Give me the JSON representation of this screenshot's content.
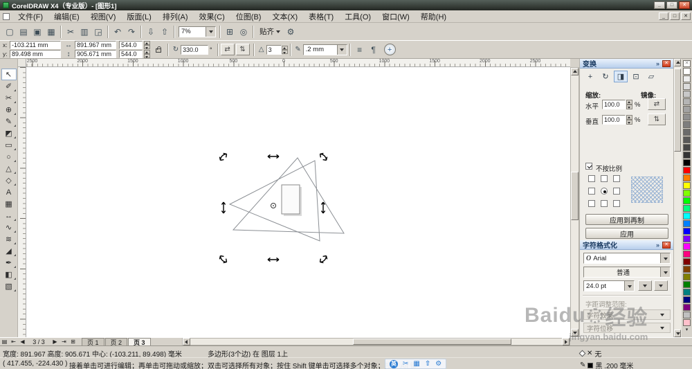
{
  "window": {
    "title": "CorelDRAW X4（专业版）- [图形1]",
    "minimize_icon": "_",
    "maximize_icon": "□",
    "close_icon": "✕"
  },
  "menu": {
    "items": [
      "文件(F)",
      "编辑(E)",
      "视图(V)",
      "版面(L)",
      "排列(A)",
      "效果(C)",
      "位图(B)",
      "文本(X)",
      "表格(T)",
      "工具(O)",
      "窗口(W)",
      "帮助(H)"
    ]
  },
  "toolbar": {
    "file_icons": [
      {
        "name": "new-document-icon",
        "glyph": "▢"
      },
      {
        "name": "open-icon",
        "glyph": "▤"
      },
      {
        "name": "save-icon",
        "glyph": "▣"
      },
      {
        "name": "print-icon",
        "glyph": "▦"
      }
    ],
    "edit_icons": [
      {
        "name": "cut-icon",
        "glyph": "✂"
      },
      {
        "name": "copy-icon",
        "glyph": "▥"
      },
      {
        "name": "paste-icon",
        "glyph": "◲"
      }
    ],
    "undo_icons": [
      {
        "name": "undo-icon",
        "glyph": "↶"
      },
      {
        "name": "redo-icon",
        "glyph": "↷"
      }
    ],
    "io_icons": [
      {
        "name": "import-icon",
        "glyph": "⇩"
      },
      {
        "name": "export-icon",
        "glyph": "⇧"
      }
    ],
    "zoom_value": "7%",
    "app_icons": [
      {
        "name": "app-launcher-icon",
        "glyph": "⊞"
      },
      {
        "name": "corel-online-icon",
        "glyph": "◎"
      }
    ],
    "snap_label": "贴齐",
    "options_icon": "⚙"
  },
  "propbar": {
    "x_label": "x:",
    "x_value": "-103.211 mm",
    "y_label": "y:",
    "y_value": "89.498 mm",
    "width_value": "891.967 mm",
    "height_value": "905.671 mm",
    "scale_h_value": "544.0",
    "scale_v_value": "544.0",
    "angle_value": "330.0",
    "angle_unit": "°",
    "points_value": "3",
    "outline_value": ".2 mm",
    "icons": {
      "rotate": "↻",
      "mirror_h": "⇄",
      "mirror_v": "⇅",
      "polygon": "△",
      "pen": "✎",
      "size_h": "↔",
      "size_v": "↕",
      "wrap": "≡",
      "paragraph": "¶",
      "quick": "+"
    }
  },
  "ruler": {
    "labels": [
      "2500",
      "2000",
      "1500",
      "1000",
      "500",
      "0",
      "500",
      "1000",
      "1500",
      "2000",
      "2500"
    ]
  },
  "toolbox": {
    "tools": [
      {
        "name": "pick-tool",
        "glyph": "↖",
        "active": true
      },
      {
        "name": "shape-tool",
        "glyph": "✐",
        "fly": true
      },
      {
        "name": "crop-tool",
        "glyph": "✂",
        "fly": true
      },
      {
        "name": "zoom-tool",
        "glyph": "⊕",
        "fly": true
      },
      {
        "name": "freehand-tool",
        "glyph": "✎",
        "fly": true
      },
      {
        "name": "smart-fill-tool",
        "glyph": "◩",
        "fly": true
      },
      {
        "name": "rectangle-tool",
        "glyph": "▭",
        "fly": true
      },
      {
        "name": "ellipse-tool",
        "glyph": "○",
        "fly": true
      },
      {
        "name": "polygon-tool",
        "glyph": "△",
        "fly": true
      },
      {
        "name": "basic-shapes-tool",
        "glyph": "◇",
        "fly": true
      },
      {
        "name": "text-tool",
        "glyph": "A"
      },
      {
        "name": "table-tool",
        "glyph": "▦"
      },
      {
        "name": "dimension-tool",
        "glyph": "↔",
        "fly": true
      },
      {
        "name": "connector-tool",
        "glyph": "∿",
        "fly": true
      },
      {
        "name": "blend-tool",
        "glyph": "≋",
        "fly": true
      },
      {
        "name": "eyedropper-tool",
        "glyph": "◢",
        "fly": true
      },
      {
        "name": "outline-pen-tool",
        "glyph": "✒",
        "fly": true
      },
      {
        "name": "fill-tool",
        "glyph": "◧",
        "fly": true
      },
      {
        "name": "interactive-fill-tool",
        "glyph": "▧",
        "fly": true
      }
    ]
  },
  "transform_docker": {
    "title": "变换",
    "modes": [
      {
        "name": "transform-position-button",
        "glyph": "+"
      },
      {
        "name": "transform-rotation-button",
        "glyph": "↻"
      },
      {
        "name": "transform-scale-mirror-button",
        "glyph": "◨",
        "active": true
      },
      {
        "name": "transform-size-button",
        "glyph": "⊡"
      },
      {
        "name": "transform-skew-button",
        "glyph": "▱"
      }
    ],
    "scale_label": "缩放:",
    "mirror_label": "镜像:",
    "h_label": "水平",
    "v_label": "垂直",
    "h_value": "100.0",
    "v_value": "100.0",
    "percent": "%",
    "mirror_h_icon": "⇄",
    "mirror_v_icon": "⇅",
    "nonproportional_label": "不按比例",
    "apply_duplicate_label": "应用到再制",
    "apply_label": "应用"
  },
  "char_docker": {
    "title": "字符格式化",
    "font_icon": "O",
    "font_value": "Arial",
    "style_value": "普通",
    "size_value": "24.0 pt",
    "kerning_label": "字距调整范围:",
    "section1_label": "字符效果",
    "section2_label": "字符位移"
  },
  "docker_icons": {
    "collapse": "»",
    "close": "✕"
  },
  "palette": {
    "none_mark": "✕",
    "down_icon": "▾",
    "colors": [
      "none",
      "#FFFFFF",
      "#EDEDED",
      "#DBDBDB",
      "#C8C8C8",
      "#B5B5B5",
      "#A3A3A3",
      "#909090",
      "#7E7E7E",
      "#6B6B6B",
      "#595959",
      "#464646",
      "#343434",
      "#000000",
      "#FF0000",
      "#FF8000",
      "#FFFF00",
      "#80FF00",
      "#00FF00",
      "#00FF80",
      "#00FFFF",
      "#0080FF",
      "#0000FF",
      "#8000FF",
      "#FF00FF",
      "#FF0080",
      "#800000",
      "#804000",
      "#808000",
      "#008000",
      "#008080",
      "#000080",
      "#800080",
      "#C0C0C0",
      "#FFC0CB"
    ]
  },
  "pagenav": {
    "page_icon": "▤",
    "first_icon": "⇤",
    "prev_icon": "◀",
    "page_indicator": "3 / 3",
    "next_icon": "▶",
    "last_icon": "⇥",
    "add_icon": "⊞",
    "tabs": [
      {
        "name": "page-tab-1",
        "label": "页 1"
      },
      {
        "name": "page-tab-2",
        "label": "页 2"
      },
      {
        "name": "page-tab-3",
        "label": "页 3",
        "active": true
      }
    ]
  },
  "status": {
    "size_info": "宽度: 891.967  高度: 905.671  中心: (-103.211, 89.498) 毫米",
    "object_info": "多边形(3个边) 在 图层 1上",
    "fill_none_mark": "✕",
    "fill_none_label": "无",
    "coords": "( 417.455, -224.430 )",
    "hint": "接着单击可进行编辑；再单击可拖动或缩放；双击可选择所有对象；按住 Shift 键单击可选择多个对象；按住 Alt 键",
    "outline_pen_icon": "✎",
    "outline_label": "黑 .200 毫米",
    "ime_icons": [
      {
        "name": "ime-language-icon",
        "glyph": "英"
      },
      {
        "name": "ime-cut-icon",
        "glyph": "✂"
      },
      {
        "name": "ime-keyboard-icon",
        "glyph": "▦"
      },
      {
        "name": "ime-up-icon",
        "glyph": "⇧"
      },
      {
        "name": "ime-settings-icon",
        "glyph": "⚙"
      }
    ]
  },
  "watermark": {
    "brand": "Baidu",
    "suffix": "经验",
    "url": "jingyan.baidu.com"
  }
}
